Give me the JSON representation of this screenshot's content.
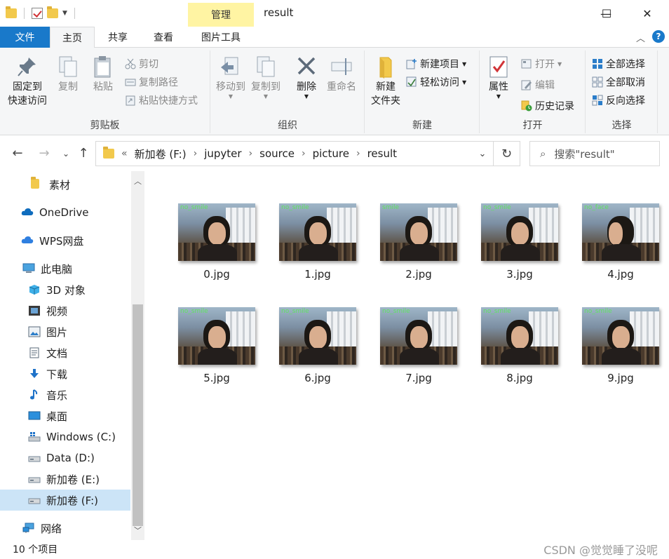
{
  "titlebar": {
    "context_tab": "管理",
    "title": "result",
    "minimize_glyph": "—",
    "maximize_glyph": "☐",
    "close_glyph": "✕"
  },
  "ribbon_tabs": {
    "file": "文件",
    "home": "主页",
    "share": "共享",
    "view": "查看",
    "picture_tools": "图片工具",
    "help": "?"
  },
  "ribbon": {
    "clipboard": {
      "label": "剪贴板",
      "pin_line1": "固定到",
      "pin_line2": "快速访问",
      "copy": "复制",
      "paste": "粘贴",
      "cut": "剪切",
      "copy_path": "复制路径",
      "paste_shortcut": "粘贴快捷方式"
    },
    "organize": {
      "label": "组织",
      "move_to": "移动到",
      "copy_to": "复制到",
      "delete": "删除",
      "rename": "重命名"
    },
    "new": {
      "label": "新建",
      "new_folder_line1": "新建",
      "new_folder_line2": "文件夹",
      "new_item": "新建项目",
      "easy_access": "轻松访问"
    },
    "open": {
      "label": "打开",
      "properties": "属性",
      "open": "打开",
      "edit": "编辑",
      "history": "历史记录"
    },
    "select": {
      "label": "选择",
      "select_all": "全部选择",
      "select_none": "全部取消",
      "invert": "反向选择"
    }
  },
  "address": {
    "prefix": "«",
    "crumbs": [
      "新加卷 (F:)",
      "jupyter",
      "source",
      "picture",
      "result"
    ],
    "search_placeholder": "搜索\"result\""
  },
  "navpane": {
    "items": [
      {
        "label": "素材",
        "icon": "folder-icon"
      },
      {
        "label": "OneDrive",
        "icon": "cloud-icon"
      },
      {
        "label": "WPS网盘",
        "icon": "cloud-icon"
      },
      {
        "label": "此电脑",
        "icon": "computer-icon"
      },
      {
        "label": "3D 对象",
        "icon": "cube-icon"
      },
      {
        "label": "视频",
        "icon": "video-icon"
      },
      {
        "label": "图片",
        "icon": "pictures-icon"
      },
      {
        "label": "文档",
        "icon": "document-icon"
      },
      {
        "label": "下载",
        "icon": "download-icon"
      },
      {
        "label": "音乐",
        "icon": "music-icon"
      },
      {
        "label": "桌面",
        "icon": "desktop-icon"
      },
      {
        "label": "Windows (C:)",
        "icon": "drive-icon"
      },
      {
        "label": "Data (D:)",
        "icon": "drive-icon"
      },
      {
        "label": "新加卷 (E:)",
        "icon": "drive-icon"
      },
      {
        "label": "新加卷 (F:)",
        "icon": "drive-icon"
      },
      {
        "label": "网络",
        "icon": "network-icon"
      }
    ],
    "selected_index": 14
  },
  "files": [
    {
      "name": "0.jpg",
      "overlay": "no_smile"
    },
    {
      "name": "1.jpg",
      "overlay": "no_smile"
    },
    {
      "name": "2.jpg",
      "overlay": "smile"
    },
    {
      "name": "3.jpg",
      "overlay": "no_smile"
    },
    {
      "name": "4.jpg",
      "overlay": "no_face"
    },
    {
      "name": "5.jpg",
      "overlay": "no_smile"
    },
    {
      "name": "6.jpg",
      "overlay": "no_smile"
    },
    {
      "name": "7.jpg",
      "overlay": "no_smile"
    },
    {
      "name": "8.jpg",
      "overlay": "no_smile"
    },
    {
      "name": "9.jpg",
      "overlay": "no_smile"
    }
  ],
  "status": {
    "count": "10 个项目",
    "watermark": "CSDN @觉觉睡了没呢"
  },
  "colors": {
    "accent": "#1979ca",
    "manage_tab": "#fff4a3",
    "selection": "#cce4f7"
  }
}
